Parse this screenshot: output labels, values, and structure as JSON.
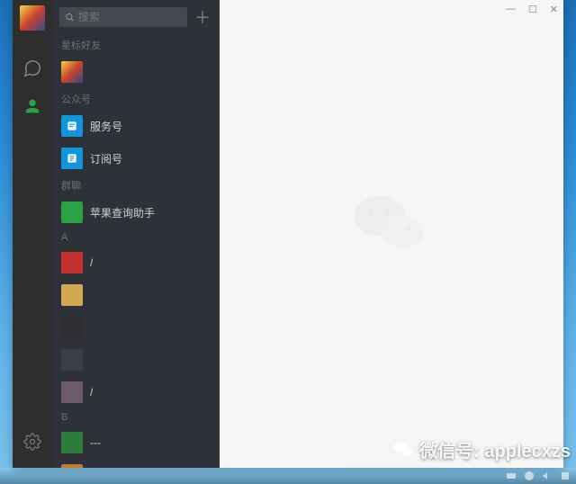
{
  "search": {
    "placeholder": "搜索"
  },
  "sections": {
    "starred": "星标好友",
    "official": "公众号",
    "service": "服务号",
    "subscribe": "订阅号",
    "group": "群聊",
    "group_item": "苹果查询助手",
    "letterA": "A",
    "letterB": "B"
  },
  "contactsA": [
    {
      "name": "/",
      "color": "#c23030"
    },
    {
      "name": "",
      "color": "#d4a853"
    },
    {
      "name": "",
      "color": "#2e2e2e"
    },
    {
      "name": "",
      "color": "#3c3c4a"
    },
    {
      "name": "/",
      "color": "#6b5a6b"
    }
  ],
  "contactsB": [
    {
      "name": "---",
      "color": "#2e7d3e"
    },
    {
      "name": "",
      "color": "#c77a2e"
    }
  ],
  "watermark": "微信号: applecxzs"
}
